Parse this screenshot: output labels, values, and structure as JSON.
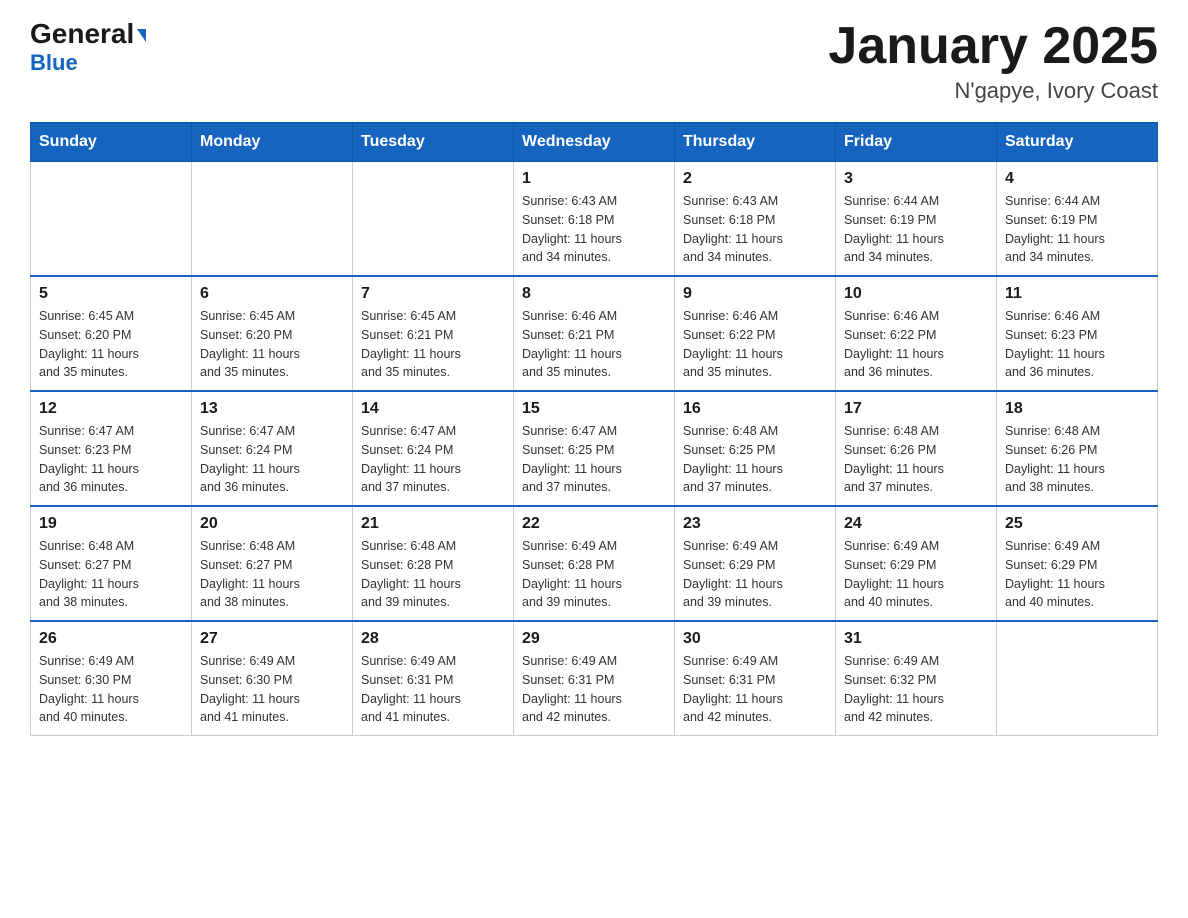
{
  "header": {
    "logo_general": "General",
    "logo_blue": "Blue",
    "title": "January 2025",
    "subtitle": "N'gapye, Ivory Coast"
  },
  "days_of_week": [
    "Sunday",
    "Monday",
    "Tuesday",
    "Wednesday",
    "Thursday",
    "Friday",
    "Saturday"
  ],
  "weeks": [
    [
      {
        "day": "",
        "info": ""
      },
      {
        "day": "",
        "info": ""
      },
      {
        "day": "",
        "info": ""
      },
      {
        "day": "1",
        "info": "Sunrise: 6:43 AM\nSunset: 6:18 PM\nDaylight: 11 hours\nand 34 minutes."
      },
      {
        "day": "2",
        "info": "Sunrise: 6:43 AM\nSunset: 6:18 PM\nDaylight: 11 hours\nand 34 minutes."
      },
      {
        "day": "3",
        "info": "Sunrise: 6:44 AM\nSunset: 6:19 PM\nDaylight: 11 hours\nand 34 minutes."
      },
      {
        "day": "4",
        "info": "Sunrise: 6:44 AM\nSunset: 6:19 PM\nDaylight: 11 hours\nand 34 minutes."
      }
    ],
    [
      {
        "day": "5",
        "info": "Sunrise: 6:45 AM\nSunset: 6:20 PM\nDaylight: 11 hours\nand 35 minutes."
      },
      {
        "day": "6",
        "info": "Sunrise: 6:45 AM\nSunset: 6:20 PM\nDaylight: 11 hours\nand 35 minutes."
      },
      {
        "day": "7",
        "info": "Sunrise: 6:45 AM\nSunset: 6:21 PM\nDaylight: 11 hours\nand 35 minutes."
      },
      {
        "day": "8",
        "info": "Sunrise: 6:46 AM\nSunset: 6:21 PM\nDaylight: 11 hours\nand 35 minutes."
      },
      {
        "day": "9",
        "info": "Sunrise: 6:46 AM\nSunset: 6:22 PM\nDaylight: 11 hours\nand 35 minutes."
      },
      {
        "day": "10",
        "info": "Sunrise: 6:46 AM\nSunset: 6:22 PM\nDaylight: 11 hours\nand 36 minutes."
      },
      {
        "day": "11",
        "info": "Sunrise: 6:46 AM\nSunset: 6:23 PM\nDaylight: 11 hours\nand 36 minutes."
      }
    ],
    [
      {
        "day": "12",
        "info": "Sunrise: 6:47 AM\nSunset: 6:23 PM\nDaylight: 11 hours\nand 36 minutes."
      },
      {
        "day": "13",
        "info": "Sunrise: 6:47 AM\nSunset: 6:24 PM\nDaylight: 11 hours\nand 36 minutes."
      },
      {
        "day": "14",
        "info": "Sunrise: 6:47 AM\nSunset: 6:24 PM\nDaylight: 11 hours\nand 37 minutes."
      },
      {
        "day": "15",
        "info": "Sunrise: 6:47 AM\nSunset: 6:25 PM\nDaylight: 11 hours\nand 37 minutes."
      },
      {
        "day": "16",
        "info": "Sunrise: 6:48 AM\nSunset: 6:25 PM\nDaylight: 11 hours\nand 37 minutes."
      },
      {
        "day": "17",
        "info": "Sunrise: 6:48 AM\nSunset: 6:26 PM\nDaylight: 11 hours\nand 37 minutes."
      },
      {
        "day": "18",
        "info": "Sunrise: 6:48 AM\nSunset: 6:26 PM\nDaylight: 11 hours\nand 38 minutes."
      }
    ],
    [
      {
        "day": "19",
        "info": "Sunrise: 6:48 AM\nSunset: 6:27 PM\nDaylight: 11 hours\nand 38 minutes."
      },
      {
        "day": "20",
        "info": "Sunrise: 6:48 AM\nSunset: 6:27 PM\nDaylight: 11 hours\nand 38 minutes."
      },
      {
        "day": "21",
        "info": "Sunrise: 6:48 AM\nSunset: 6:28 PM\nDaylight: 11 hours\nand 39 minutes."
      },
      {
        "day": "22",
        "info": "Sunrise: 6:49 AM\nSunset: 6:28 PM\nDaylight: 11 hours\nand 39 minutes."
      },
      {
        "day": "23",
        "info": "Sunrise: 6:49 AM\nSunset: 6:29 PM\nDaylight: 11 hours\nand 39 minutes."
      },
      {
        "day": "24",
        "info": "Sunrise: 6:49 AM\nSunset: 6:29 PM\nDaylight: 11 hours\nand 40 minutes."
      },
      {
        "day": "25",
        "info": "Sunrise: 6:49 AM\nSunset: 6:29 PM\nDaylight: 11 hours\nand 40 minutes."
      }
    ],
    [
      {
        "day": "26",
        "info": "Sunrise: 6:49 AM\nSunset: 6:30 PM\nDaylight: 11 hours\nand 40 minutes."
      },
      {
        "day": "27",
        "info": "Sunrise: 6:49 AM\nSunset: 6:30 PM\nDaylight: 11 hours\nand 41 minutes."
      },
      {
        "day": "28",
        "info": "Sunrise: 6:49 AM\nSunset: 6:31 PM\nDaylight: 11 hours\nand 41 minutes."
      },
      {
        "day": "29",
        "info": "Sunrise: 6:49 AM\nSunset: 6:31 PM\nDaylight: 11 hours\nand 42 minutes."
      },
      {
        "day": "30",
        "info": "Sunrise: 6:49 AM\nSunset: 6:31 PM\nDaylight: 11 hours\nand 42 minutes."
      },
      {
        "day": "31",
        "info": "Sunrise: 6:49 AM\nSunset: 6:32 PM\nDaylight: 11 hours\nand 42 minutes."
      },
      {
        "day": "",
        "info": ""
      }
    ]
  ]
}
